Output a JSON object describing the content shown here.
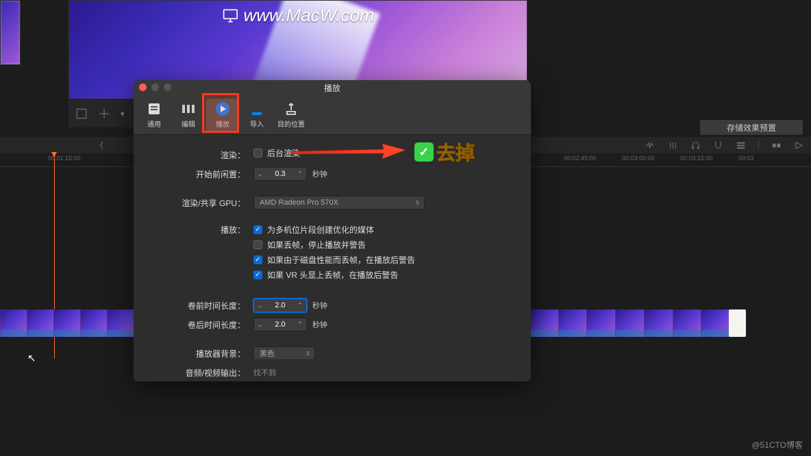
{
  "viewer": {
    "url_text": "www.MacW.com"
  },
  "toolbar": {
    "preset_button": "存储效果预置"
  },
  "timeline": {
    "ticks": [
      "00:01:15:00",
      "00:02:45:00",
      "00:03:00:00",
      "00:03:15:00",
      "00:03"
    ]
  },
  "pref": {
    "title": "播放",
    "tabs": {
      "general": "通用",
      "edit": "编辑",
      "playback": "播放",
      "import": "导入",
      "destination": "目的位置"
    },
    "labels": {
      "render": "渲染：",
      "idle_start": "开始前闲置：",
      "gpu": "渲染/共享 GPU：",
      "playback": "播放：",
      "preroll": "卷前时间长度：",
      "postroll": "卷后时间长度：",
      "player_bg": "播放器背景：",
      "av_out": "音频/视频输出："
    },
    "values": {
      "bg_render": "后台渲染",
      "idle": "0.3",
      "seconds": "秒钟",
      "gpu": "AMD Radeon Pro 570X",
      "cb1": "为多机位片段创建优化的媒体",
      "cb2": "如果丢帧，停止播放并警告",
      "cb3": "如果由于磁盘性能而丢帧，在播放后警告",
      "cb4": "如果 VR 头显上丢帧，在播放后警告",
      "preroll": "2.0",
      "postroll": "2.0",
      "bg_color": "黑色",
      "av_out": "找不到"
    }
  },
  "annotation": {
    "text": "去掉"
  },
  "watermark": "@51CTO博客"
}
